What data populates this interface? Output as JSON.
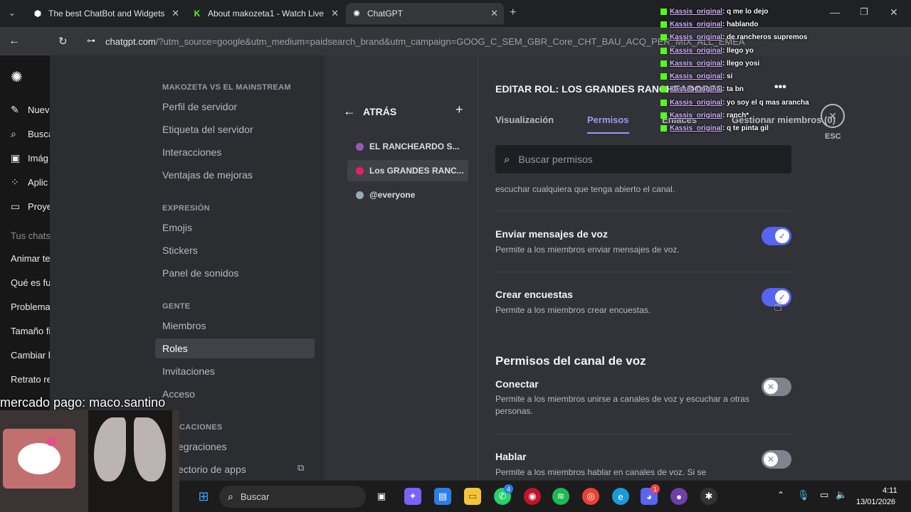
{
  "browser": {
    "tabs": [
      {
        "title": "The best ChatBot and Widgets",
        "icon": "chatbot-icon"
      },
      {
        "title": "About makozeta1 - Watch Live",
        "icon": "kick-icon"
      },
      {
        "title": "ChatGPT",
        "icon": "chatgpt-icon"
      }
    ],
    "address": "chatgpt.com",
    "address_query": "/?utm_source=google&utm_medium=paidsearch_brand&utm_campaign=GOOG_C_SEM_GBR_Core_CHT_BAU_ACQ_PER_MIX_ALL_EMEA"
  },
  "gpt_sidebar": {
    "items": [
      "Nuev",
      "Busca",
      "Imág",
      "Aplic",
      "Proye"
    ],
    "section": "Tus chats",
    "chats": [
      "Animar te",
      "Qué es fu",
      "Problema",
      "Tamaño fi",
      "Cambiar l",
      "Retrato re"
    ]
  },
  "discord_nav": {
    "server_heading": "MAKOZETA VS EL MAINSTREAM",
    "server_items": [
      "Perfil de servidor",
      "Etiqueta del servidor",
      "Interacciones",
      "Ventajas de mejoras"
    ],
    "expression_heading": "EXPRESIÓN",
    "expression_items": [
      "Emojis",
      "Stickers",
      "Panel de sonidos"
    ],
    "people_heading": "GENTE",
    "people_items": [
      "Miembros",
      "Roles",
      "Invitaciones",
      "Acceso"
    ],
    "apps_heading": "CACIONES",
    "apps_items": [
      "egraciones",
      "ectorio de apps"
    ]
  },
  "roles": {
    "back_label": "ATRÁS",
    "add_symbol": "+",
    "items": [
      {
        "name": "EL RANCHEARDO S...",
        "color": "#9b59b6"
      },
      {
        "name": "Los GRANDES RANC...",
        "color": "#e91e63"
      },
      {
        "name": "@everyone",
        "color": "#99aab5"
      }
    ]
  },
  "edit": {
    "title": "EDITAR ROL: LOS GRANDES RANCHEADORES",
    "more": "•••",
    "tabs": [
      "Visualización",
      "Permisos",
      "Enlaces",
      "Gestionar miembros (0)"
    ],
    "close_label": "ESC",
    "search_placeholder": "Buscar permisos",
    "truncated_desc": "escuchar cualquiera que tenga abierto el canal.",
    "permissions": [
      {
        "title": "Enviar mensajes de voz",
        "desc": "Permite a los miembros enviar mensajes de voz.",
        "enabled": true
      },
      {
        "title": "Crear encuestas",
        "desc": "Permite a los miembros crear encuestas.",
        "enabled": true
      }
    ],
    "voice_section": "Permisos del canal de voz",
    "voice_permissions": [
      {
        "title": "Conectar",
        "desc": "Permite a los miembros unirse a canales de voz y escuchar a otras personas.",
        "enabled": false
      },
      {
        "title": "Hablar",
        "desc": "Permite a los miembros hablar en canales de voz. Si se",
        "enabled": false
      }
    ]
  },
  "overlay": {
    "donation_text": "mercado pago: maco.santino",
    "chat": [
      {
        "user": "Kassis_original",
        "msg": ": q me lo dejo"
      },
      {
        "user": "Kassis_original",
        "msg": ": hablando"
      },
      {
        "user": "Kassis_original",
        "msg": ": de rancheros supremos"
      },
      {
        "user": "Kassis_original",
        "msg": ": llego yo"
      },
      {
        "user": "Kassis_original",
        "msg": ": llego yosi"
      },
      {
        "user": "Kassis_original",
        "msg": ": si"
      },
      {
        "user": "Kassis_original",
        "msg": ": ta bn"
      },
      {
        "user": "Kassis_original",
        "msg": ": yo soy el q mas arancha"
      },
      {
        "user": "Kassis_original",
        "msg": ": ranch*"
      },
      {
        "user": "Kassis_original",
        "msg": ": q te pinta gil"
      }
    ]
  },
  "taskbar": {
    "search_placeholder": "Buscar",
    "whatsapp_badge": "4",
    "discord_badge": "1",
    "time": "4:11",
    "date": "13/01/2026"
  }
}
